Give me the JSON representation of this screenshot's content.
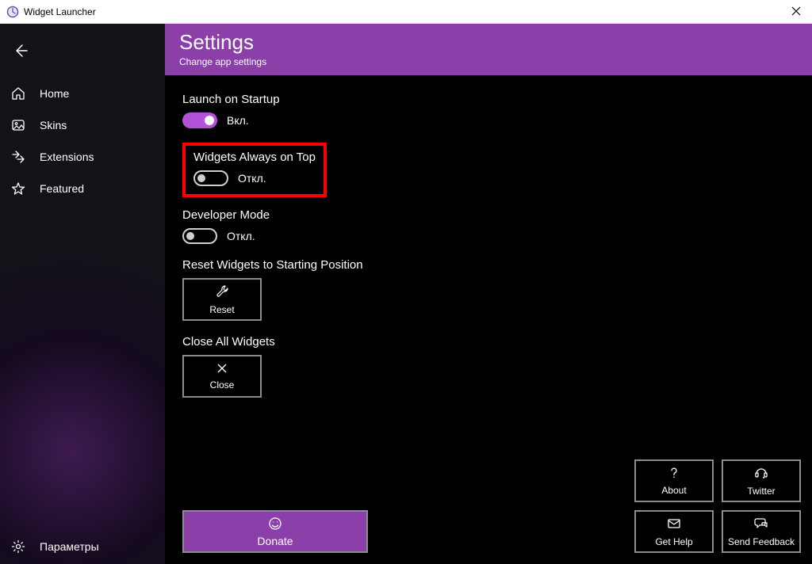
{
  "titlebar": {
    "title": "Widget Launcher"
  },
  "sidebar": {
    "items": [
      {
        "label": "Home"
      },
      {
        "label": "Skins"
      },
      {
        "label": "Extensions"
      },
      {
        "label": "Featured"
      }
    ],
    "footer": {
      "label": "Параметры"
    }
  },
  "header": {
    "title": "Settings",
    "subtitle": "Change app settings"
  },
  "settings": {
    "launch_startup": {
      "label": "Launch on Startup",
      "state": "Вкл."
    },
    "always_on_top": {
      "label": "Widgets Always on Top",
      "state": "Откл."
    },
    "dev_mode": {
      "label": "Developer Mode",
      "state": "Откл."
    },
    "reset": {
      "label": "Reset Widgets to Starting Position",
      "button": "Reset"
    },
    "close_all": {
      "label": "Close All Widgets",
      "button": "Close"
    }
  },
  "footer_buttons": {
    "donate": "Donate",
    "about": "About",
    "twitter": "Twitter",
    "get_help": "Get Help",
    "send_feedback": "Send Feedback"
  }
}
